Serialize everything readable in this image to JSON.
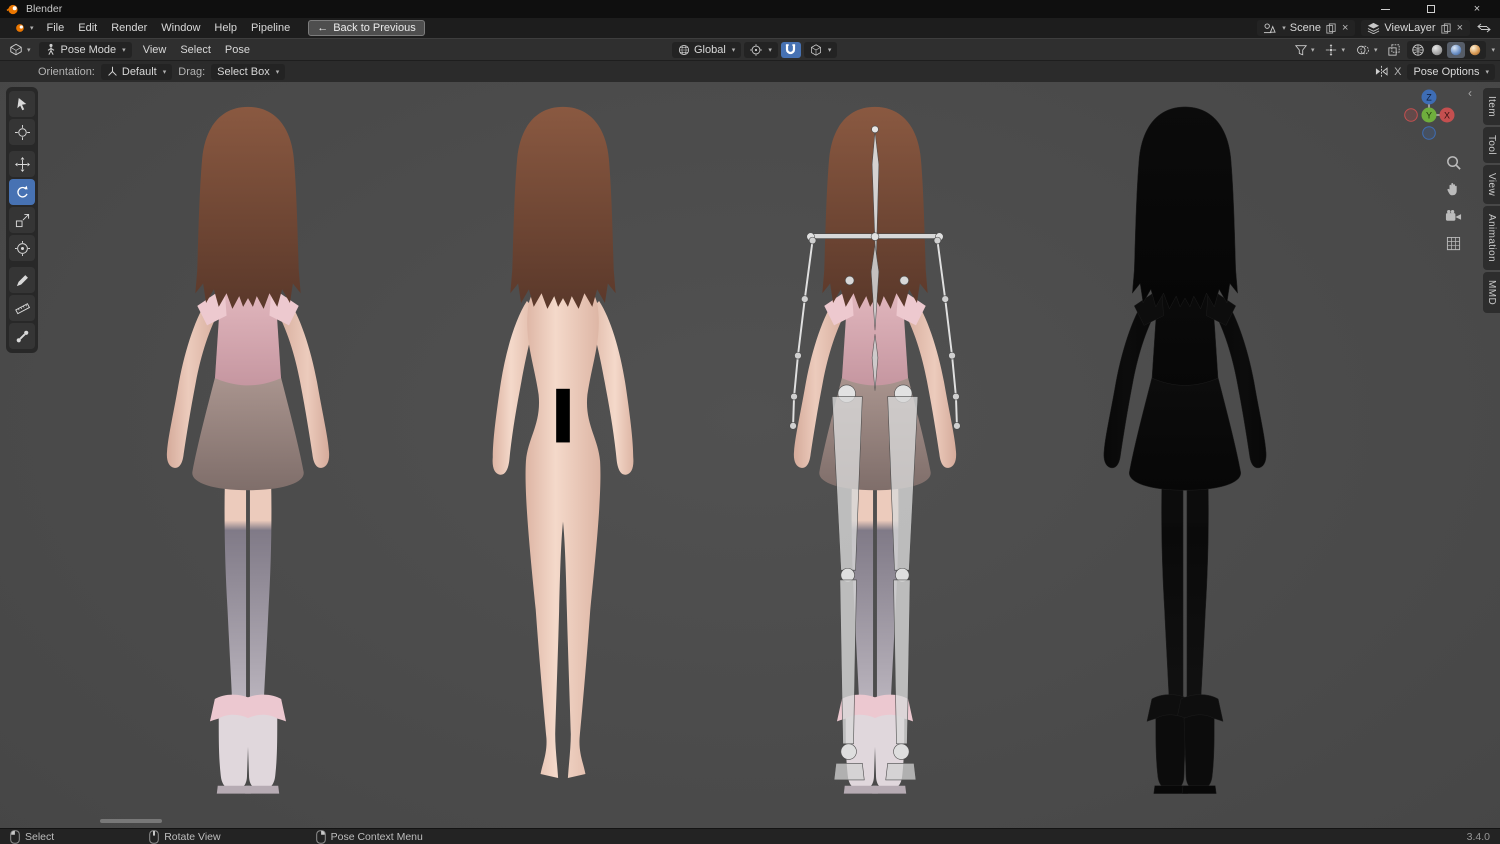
{
  "icons": {
    "caret": "▾",
    "close": "×",
    "back_arrow": "←",
    "collapse_left": "‹"
  },
  "colors": {
    "accent_blue": "#4772b3",
    "viewport_bg": "#4b4b4b",
    "header_bg": "#2f2f2f",
    "skin": "#eccbbc",
    "hair_brown": "#8a5941",
    "blouse_pink": "#e6bcc2",
    "skirt_taupe": "#a9948e",
    "stocking_gray": "#9a94a0",
    "boot_pink": "#ecc8d0",
    "bone_white": "#d8d8d8",
    "wireframe_black": "#0c0c0c",
    "censor_black": "#000000",
    "axis_x_red": "#c44f4f",
    "axis_y_green": "#6fae3d",
    "axis_z_blue": "#3e6db5"
  },
  "titlebar": {
    "title": "Blender"
  },
  "menubar": {
    "menus": [
      "File",
      "Edit",
      "Render",
      "Window",
      "Help",
      "Pipeline"
    ],
    "back_button": "Back to Previous",
    "scene": {
      "label": "Scene"
    },
    "view_layer": {
      "label": "ViewLayer"
    }
  },
  "viewport_header": {
    "mode": "Pose Mode",
    "menus": [
      "View",
      "Select",
      "Pose"
    ],
    "orientation": "Global",
    "shading_modes": [
      "wireframe",
      "solid",
      "material-preview",
      "rendered"
    ],
    "active_shading": "material-preview"
  },
  "tool_settings": {
    "orientation_label": "Orientation:",
    "orientation_value": "Default",
    "drag_label": "Drag:",
    "drag_value": "Select Box",
    "mirror_x_label": "X",
    "pose_options_label": "Pose Options"
  },
  "toolbar": {
    "tools": [
      "tweak-select",
      "cursor",
      "move",
      "rotate",
      "scale",
      "transform",
      "annotate",
      "measure",
      "pose-breakdowner"
    ],
    "active_tool": "rotate"
  },
  "gizmo": {
    "z": "Z",
    "y": "Y",
    "x": "X"
  },
  "nav_buttons": [
    "zoom",
    "pan",
    "camera-view",
    "grid-ortho"
  ],
  "sidebar_tabs": [
    "Item",
    "Tool",
    "View",
    "Animation",
    "MMD"
  ],
  "models": [
    {
      "name": "character-dressed-back",
      "variant": "dressed"
    },
    {
      "name": "character-body-back",
      "variant": "nude"
    },
    {
      "name": "character-armature-pose",
      "variant": "armature"
    },
    {
      "name": "character-wireframe",
      "variant": "wireframe"
    }
  ],
  "statusbar": {
    "hints": [
      {
        "icon": "mouse-left",
        "label": "Select"
      },
      {
        "icon": "mouse-middle",
        "label": "Rotate View"
      },
      {
        "icon": "mouse-right",
        "label": "Pose Context Menu"
      }
    ],
    "version": "3.4.0"
  }
}
